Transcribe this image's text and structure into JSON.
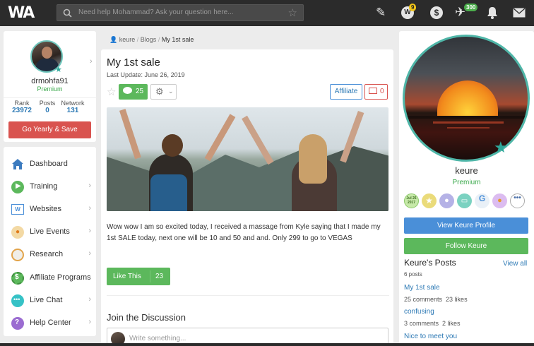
{
  "topbar": {
    "logo": "WA",
    "search_placeholder": "Need help Mohammad? Ask your question here...",
    "notifications_count": "9",
    "network_count": "300",
    "icons": [
      "pencil-icon",
      "notifications-icon",
      "dollar-icon",
      "plane-icon",
      "bell-icon",
      "mail-icon"
    ]
  },
  "profile": {
    "username": "drmohfa91",
    "status": "Premium",
    "stats": [
      {
        "label": "Rank",
        "value": "23972"
      },
      {
        "label": "Posts",
        "value": "0"
      },
      {
        "label": "Network",
        "value": "131"
      }
    ],
    "cta": "Go Yearly & Save"
  },
  "menu": [
    {
      "label": "Dashboard",
      "icon": "home-icon"
    },
    {
      "label": "Training",
      "icon": "play-icon"
    },
    {
      "label": "Websites",
      "icon": "websites-icon"
    },
    {
      "label": "Live Events",
      "icon": "live-events-icon"
    },
    {
      "label": "Research",
      "icon": "research-icon"
    },
    {
      "label": "Affiliate Programs",
      "icon": "affiliate-icon"
    },
    {
      "label": "Live Chat",
      "icon": "chat-icon"
    },
    {
      "label": "Help Center",
      "icon": "help-icon"
    }
  ],
  "breadcrumb": {
    "user": "keure",
    "section": "Blogs",
    "current": "My 1st sale"
  },
  "post": {
    "title": "My 1st sale",
    "updated": "Last Update: June 26, 2019",
    "comments_count": "25",
    "affiliate_label": "Affiliate",
    "mail_count": "0",
    "body": "Wow wow I am so excited today, I received a massage from Kyle saying that I made my 1st SALE today, next one will be 10 and 50 and and. Only 299 to go to VEGAS",
    "like_label": "Like This",
    "like_count": "23",
    "discussion_title": "Join the Discussion",
    "comment_placeholder": "Write something..."
  },
  "author": {
    "name": "keure",
    "status": "Premium",
    "medal_date": "Jul 26 2017",
    "view_profile": "View Keure Profile",
    "follow": "Follow Keure",
    "posts_title": "Keure's Posts",
    "view_all": "View all",
    "posts_count": "6 posts",
    "posts": [
      {
        "title": "My 1st sale",
        "comments": "25 comments",
        "likes": "23 likes"
      },
      {
        "title": "confusing",
        "comments": "3 comments",
        "likes": "2 likes"
      },
      {
        "title": "Nice to meet you"
      }
    ]
  },
  "colors": {
    "topbar": "#2b2b2b",
    "accent_green": "#5cb85c",
    "accent_blue": "#4a8fd8",
    "cta_red": "#d9534f",
    "premium": "#3aa94b",
    "link": "#2e7ab5"
  }
}
